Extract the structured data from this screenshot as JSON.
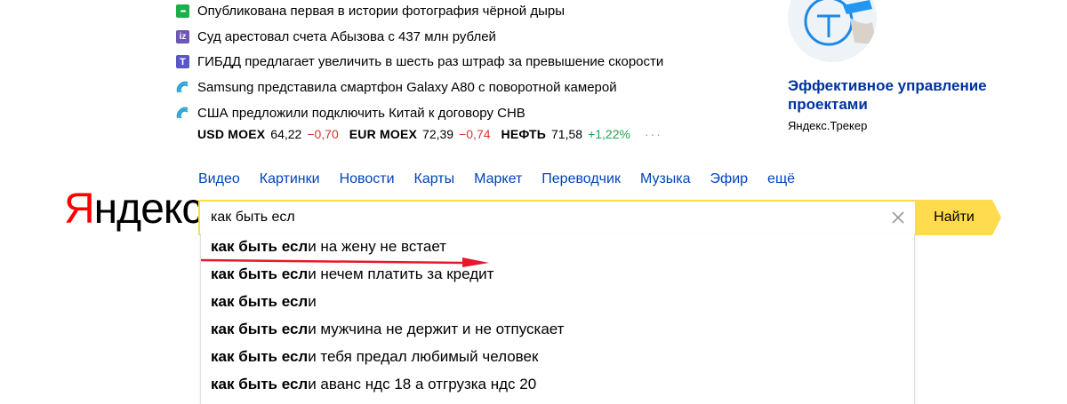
{
  "news": [
    {
      "icon": "green-news-source-icon",
      "text": "Опубликована первая в истории фотография чёрной дыры"
    },
    {
      "icon": "izvestia-icon",
      "text": "Суд арестовал счета Абызова с 437 млн рублей"
    },
    {
      "icon": "t-source-icon",
      "text": "ГИБДД предлагает увеличить в шесть раз штраф за превышение скорости"
    },
    {
      "icon": "ria-icon",
      "text": "Samsung представила смартфон Galaxy A80 с поворотной камерой"
    },
    {
      "icon": "ria-icon",
      "text": "США предложили подключить Китай к договору СНВ"
    }
  ],
  "rates": [
    {
      "name": "USD MOEX",
      "value": "64,22",
      "change": "−0,70",
      "trend": "down"
    },
    {
      "name": "EUR MOEX",
      "value": "72,39",
      "change": "−0,74",
      "trend": "down"
    },
    {
      "name": "НЕФТЬ",
      "value": "71,58",
      "change": "+1,22%",
      "trend": "up"
    }
  ],
  "rates_more": "···",
  "ad": {
    "title": "Эффективное управление проектами",
    "subtitle": "Яндекс.Трекер",
    "image_icon": "yandex-tracker-promo-icon"
  },
  "services": [
    "Видео",
    "Картинки",
    "Новости",
    "Карты",
    "Маркет",
    "Переводчик",
    "Музыка",
    "Эфир",
    "ещё"
  ],
  "logo": {
    "first": "Я",
    "rest": "ндекс"
  },
  "search": {
    "value": "как быть есл",
    "button": "Найти",
    "accent": "#ffdb4d"
  },
  "suggestions": [
    {
      "bold": "как быть есл",
      "rest": "и на жену не встает"
    },
    {
      "bold": "как быть есл",
      "rest": "и нечем платить за кредит"
    },
    {
      "bold": "как быть есл",
      "rest": "и"
    },
    {
      "bold": "как быть есл",
      "rest": "и мужчина не держит и не отпускает"
    },
    {
      "bold": "как быть есл",
      "rest": "и тебя предал любимый человек"
    },
    {
      "bold": "как быть есл",
      "rest": "и аванс ндс 18 а отгрузка ндс 20"
    }
  ],
  "colors": {
    "link": "#0044bb",
    "negative": "#e0302c",
    "positive": "#1aa84b",
    "annotation": "#e8182a"
  }
}
